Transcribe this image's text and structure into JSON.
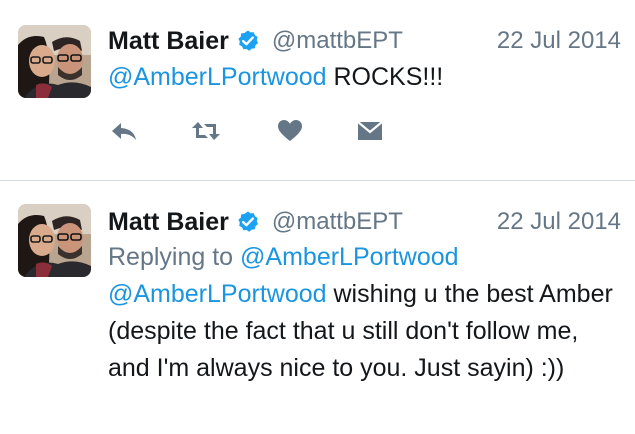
{
  "tweets": [
    {
      "author_name": "Matt Baier",
      "handle": "@mattbEPT",
      "date": "22 Jul 2014",
      "mention": "@AmberLPortwood",
      "text": " ROCKS!!!",
      "actions": {
        "reply_icon": "reply-icon",
        "retweet_icon": "retweet-icon",
        "like_icon": "heart-icon",
        "dm_icon": "envelope-icon"
      }
    },
    {
      "author_name": "Matt Baier",
      "handle": "@mattbEPT",
      "date": "22 Jul 2014",
      "replying_prefix": "Replying to ",
      "replying_to": "@AmberLPortwood",
      "mention": "@AmberLPortwood",
      "text": " wishing u the best Amber (despite the fact that u still don't follow me, and I'm always nice to you. Just sayin) :))"
    }
  ],
  "colors": {
    "link": "#1b95e0",
    "secondary_text": "#657786",
    "primary_text": "#14171a",
    "verified_badge": "#1da1f2",
    "action_icon": "#657786",
    "divider": "#d6dbe0"
  }
}
